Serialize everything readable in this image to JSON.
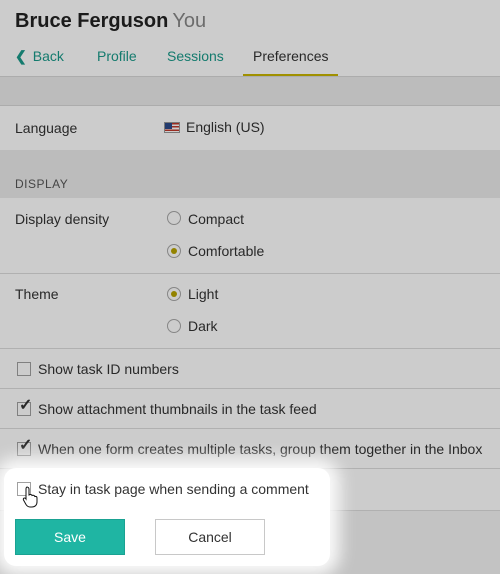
{
  "header": {
    "name": "Bruce Ferguson",
    "you_label": "You"
  },
  "nav": {
    "back_label": "Back",
    "tabs": [
      {
        "label": "Profile",
        "active": false
      },
      {
        "label": "Sessions",
        "active": false
      },
      {
        "label": "Preferences",
        "active": true
      }
    ]
  },
  "language": {
    "label": "Language",
    "value": "English (US)",
    "flag_icon": "us-flag-icon"
  },
  "display_section": {
    "title": "DISPLAY"
  },
  "display_density": {
    "label": "Display density",
    "options": [
      {
        "label": "Compact",
        "selected": false
      },
      {
        "label": "Comfortable",
        "selected": true
      }
    ]
  },
  "theme": {
    "label": "Theme",
    "options": [
      {
        "label": "Light",
        "selected": true
      },
      {
        "label": "Dark",
        "selected": false
      }
    ]
  },
  "checkboxes": [
    {
      "label": "Show task ID numbers",
      "checked": false
    },
    {
      "label": "Show attachment thumbnails in the task feed",
      "checked": true
    },
    {
      "label": "When one form creates multiple tasks, group them together in the Inbox",
      "checked": true
    },
    {
      "label": "Stay in task page when sending a comment",
      "checked": false
    }
  ],
  "actions": {
    "save_label": "Save",
    "cancel_label": "Cancel"
  },
  "colors": {
    "accent_teal": "#1fb5a3",
    "active_tab_underline": "#c8b400",
    "radio_selected": "#b8a400"
  }
}
